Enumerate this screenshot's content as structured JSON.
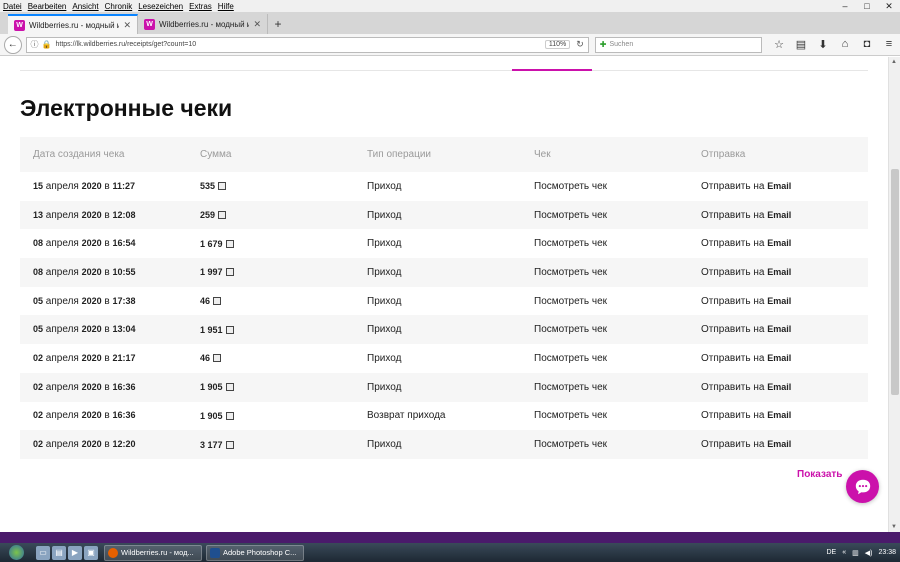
{
  "menu": [
    "Datei",
    "Bearbeiten",
    "Ansicht",
    "Chronik",
    "Lesezeichen",
    "Extras",
    "Hilfe"
  ],
  "tabs": [
    {
      "favicon": "W",
      "title": "Wildberries.ru - модный и..."
    },
    {
      "favicon": "W",
      "title": "Wildberries.ru - модный и..."
    }
  ],
  "nav": {
    "url": "https://lk.wildberries.ru/receipts/get?count=10",
    "zoom": "110%",
    "search_placeholder": "Suchen"
  },
  "page": {
    "heading": "Электронные чеки",
    "columns": [
      "Дата создания чека",
      "Сумма",
      "Тип операции",
      "Чек",
      "Отправка"
    ],
    "rows": [
      {
        "day": "15",
        "month": "апреля",
        "year": "2020",
        "time": "11:27",
        "amount": "535",
        "type": "Приход",
        "receipt": "Посмотреть чек",
        "send": "Отправить на",
        "channel": "Email"
      },
      {
        "day": "13",
        "month": "апреля",
        "year": "2020",
        "time": "12:08",
        "amount": "259",
        "type": "Приход",
        "receipt": "Посмотреть чек",
        "send": "Отправить на",
        "channel": "Email"
      },
      {
        "day": "08",
        "month": "апреля",
        "year": "2020",
        "time": "16:54",
        "amount": "1 679",
        "type": "Приход",
        "receipt": "Посмотреть чек",
        "send": "Отправить на",
        "channel": "Email"
      },
      {
        "day": "08",
        "month": "апреля",
        "year": "2020",
        "time": "10:55",
        "amount": "1 997",
        "type": "Приход",
        "receipt": "Посмотреть чек",
        "send": "Отправить на",
        "channel": "Email"
      },
      {
        "day": "05",
        "month": "апреля",
        "year": "2020",
        "time": "17:38",
        "amount": "46",
        "type": "Приход",
        "receipt": "Посмотреть чек",
        "send": "Отправить на",
        "channel": "Email"
      },
      {
        "day": "05",
        "month": "апреля",
        "year": "2020",
        "time": "13:04",
        "amount": "1 951",
        "type": "Приход",
        "receipt": "Посмотреть чек",
        "send": "Отправить на",
        "channel": "Email"
      },
      {
        "day": "02",
        "month": "апреля",
        "year": "2020",
        "time": "21:17",
        "amount": "46",
        "type": "Приход",
        "receipt": "Посмотреть чек",
        "send": "Отправить на",
        "channel": "Email"
      },
      {
        "day": "02",
        "month": "апреля",
        "year": "2020",
        "time": "16:36",
        "amount": "1 905",
        "type": "Приход",
        "receipt": "Посмотреть чек",
        "send": "Отправить на",
        "channel": "Email"
      },
      {
        "day": "02",
        "month": "апреля",
        "year": "2020",
        "time": "16:36",
        "amount": "1 905",
        "type": "Возврат прихода",
        "receipt": "Посмотреть чек",
        "send": "Отправить на",
        "channel": "Email"
      },
      {
        "day": "02",
        "month": "апреля",
        "year": "2020",
        "time": "12:20",
        "amount": "3 177",
        "type": "Приход",
        "receipt": "Посмотреть чек",
        "send": "Отправить на",
        "channel": "Email"
      }
    ],
    "date_in": "в",
    "show_more": "Показать",
    "accent_color": "#cb11ab"
  },
  "taskbar": {
    "buttons": [
      "Wildberries.ru - мод...",
      "Adobe Photoshop C..."
    ],
    "lang": "DE",
    "clock": "23:38"
  }
}
